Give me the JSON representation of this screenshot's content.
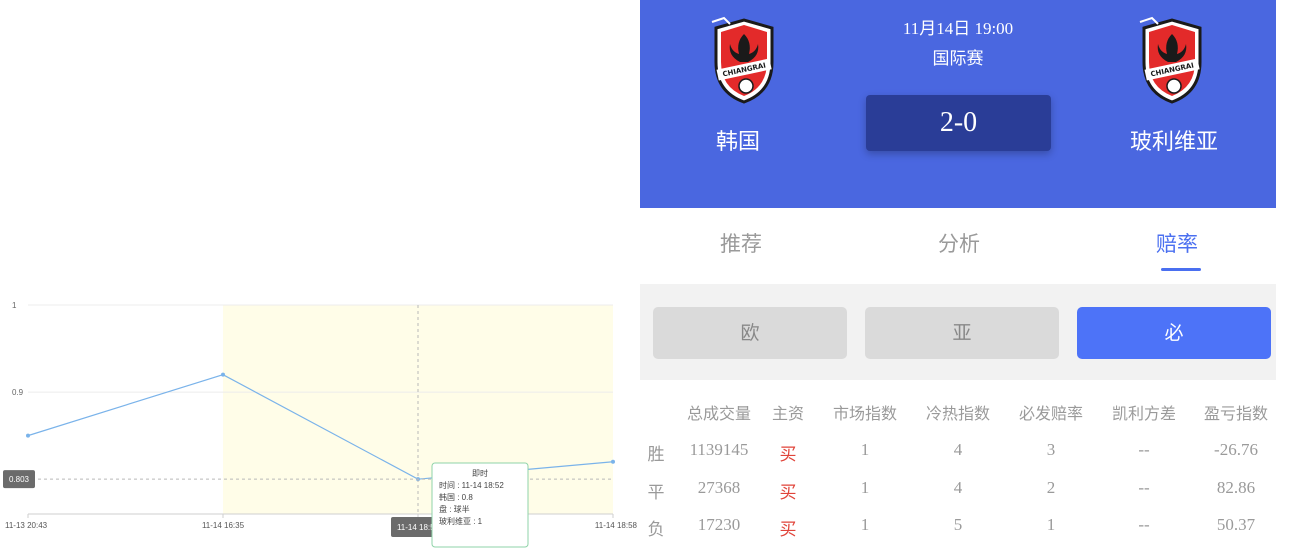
{
  "chart_data": {
    "type": "line",
    "x": [
      "11-13 20:43",
      "11-14 16:35",
      "11-14 18:52",
      "11-14 18:58"
    ],
    "series": [
      {
        "values": [
          0.85,
          0.92,
          0.8,
          0.82
        ]
      }
    ],
    "yticks": [
      "1",
      "0.9"
    ],
    "ylim": [
      0.76,
      1.0
    ],
    "current_value_label": "0.803",
    "crosshair_x_label": "11-14 18:52",
    "tooltip": {
      "title": "即时",
      "lines": [
        "时间 : 11-14 18:52",
        "韩国 : 0.8",
        "盘 : 球半",
        "玻利维亚 : 1"
      ]
    },
    "highlight_band_from": "11-14 16:35",
    "colors": {
      "line": "#7ab3ea",
      "band": "#fffde8",
      "grid": "#ececec"
    }
  },
  "match": {
    "time": "11月14日 19:00",
    "league": "国际赛",
    "score": "2-0",
    "home": "韩国",
    "away": "玻利维亚",
    "crest_text": "CHIANGRAI"
  },
  "tabs": [
    "推荐",
    "分析",
    "赔率"
  ],
  "segments": [
    "欧",
    "亚",
    "必"
  ],
  "odds": {
    "headers": [
      "总成交量",
      "主资",
      "市场指数",
      "冷热指数",
      "必发赔率",
      "凯利方差",
      "盈亏指数"
    ],
    "rows": [
      {
        "label": "胜",
        "cells": [
          "1139145",
          "买",
          "1",
          "4",
          "3",
          "--",
          "-26.76"
        ]
      },
      {
        "label": "平",
        "cells": [
          "27368",
          "买",
          "1",
          "4",
          "2",
          "--",
          "82.86"
        ]
      },
      {
        "label": "负",
        "cells": [
          "17230",
          "买",
          "1",
          "5",
          "1",
          "--",
          "50.37"
        ]
      }
    ]
  },
  "colors": {
    "header_bg": "#4a67e0",
    "accent": "#4a6ff0",
    "buy": "#e0443a",
    "score_bg": "#2a3d97"
  }
}
